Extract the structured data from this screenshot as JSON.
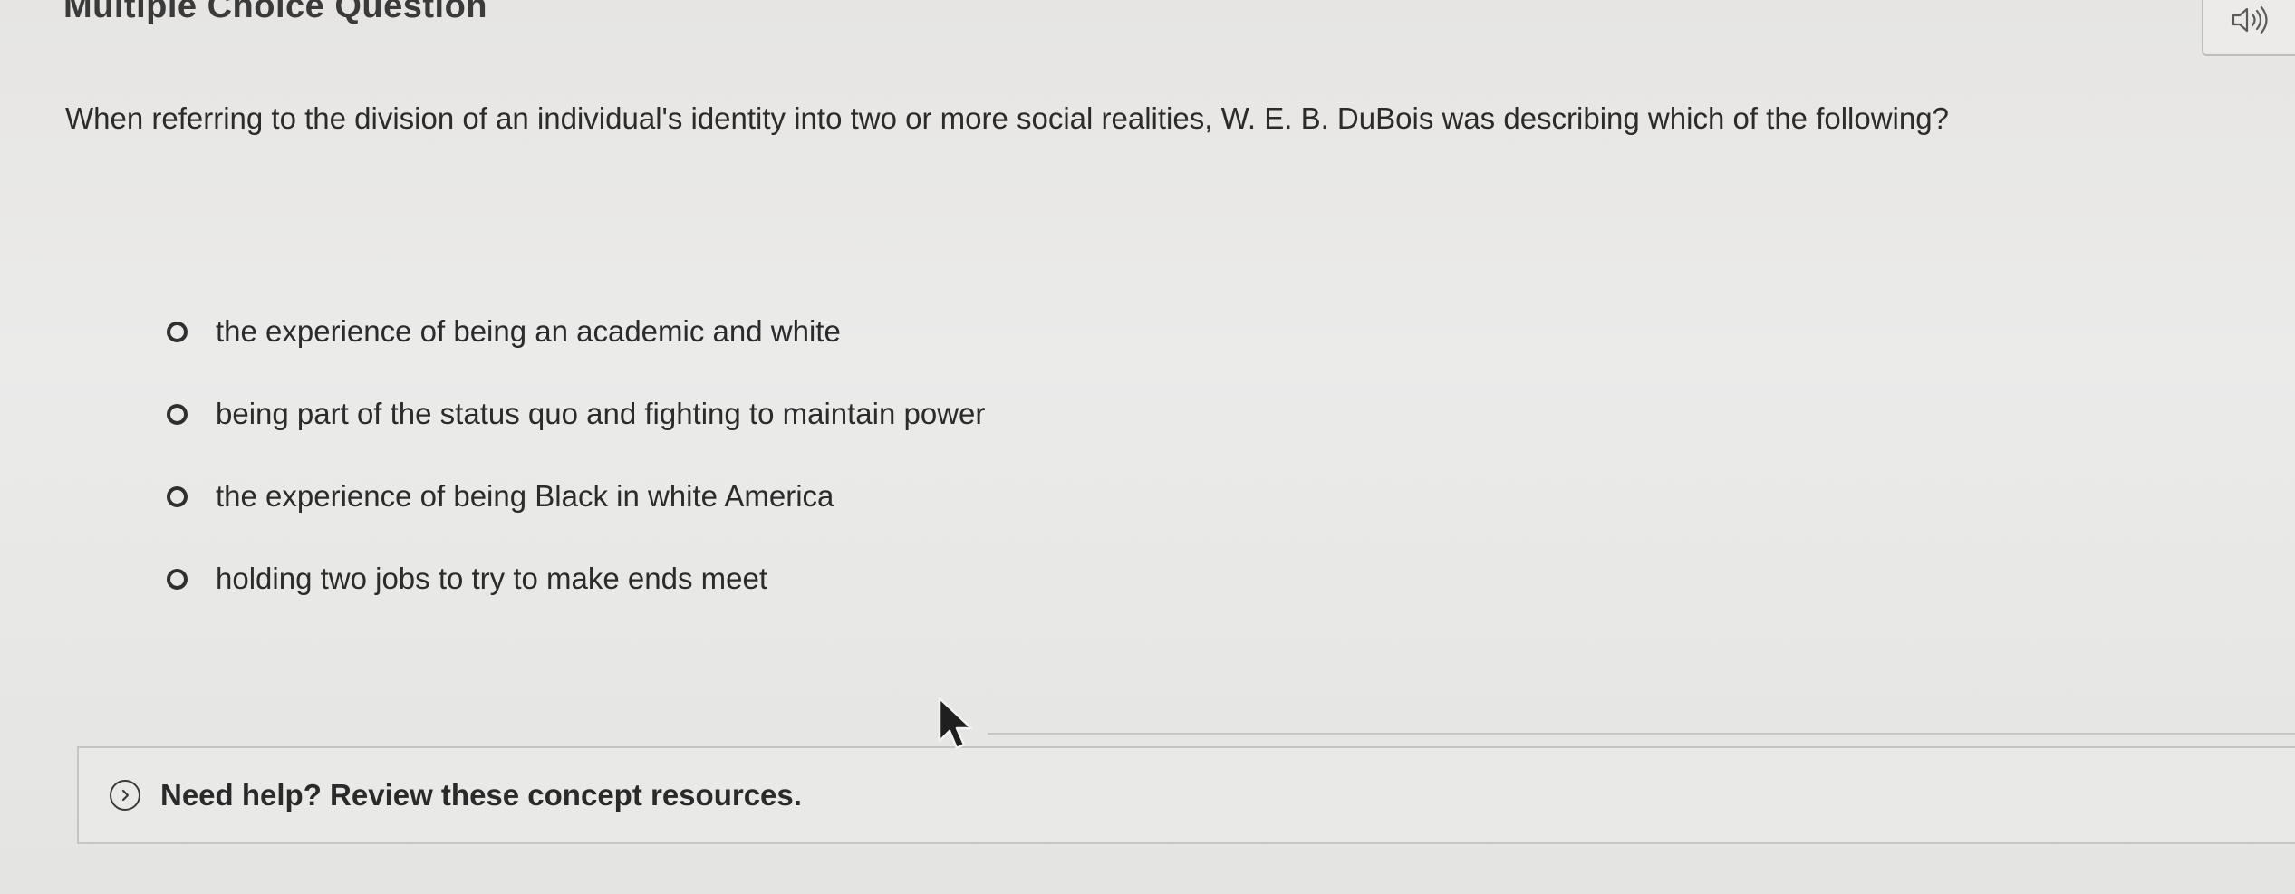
{
  "header": {
    "title": "Multiple Choice Question",
    "audio_icon": "speaker-icon"
  },
  "question": {
    "text": "When referring to the division of an individual's identity into two or more social realities, W. E. B. DuBois was describing which of the following?"
  },
  "options": [
    {
      "label": "the experience of being an academic and white",
      "selected": false
    },
    {
      "label": "being part of the status quo and fighting to maintain power",
      "selected": false
    },
    {
      "label": "the experience of being Black in white America",
      "selected": false
    },
    {
      "label": "holding two jobs to try to make ends meet",
      "selected": false
    }
  ],
  "help": {
    "label": "Need help? Review these concept resources.",
    "icon": "chevron-right-circle-icon"
  }
}
